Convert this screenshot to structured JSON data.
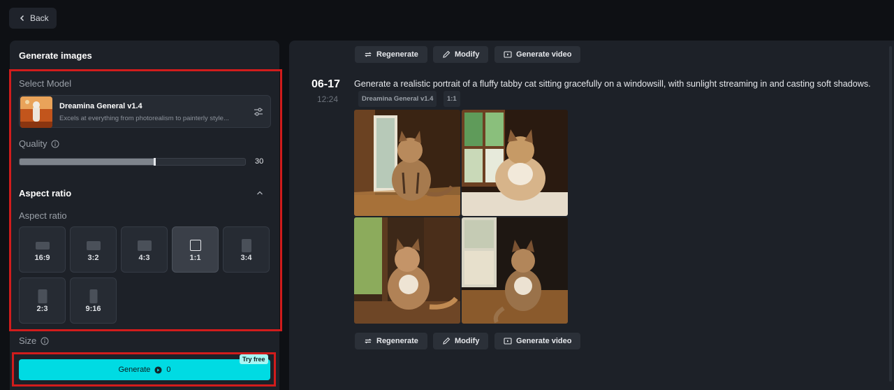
{
  "back": {
    "label": "Back"
  },
  "left_panel": {
    "title": "Generate images",
    "select_model_label": "Select Model",
    "model": {
      "name": "Dreamina General v1.4",
      "description": "Excels at everything from photorealism to painterly style..."
    },
    "quality": {
      "label": "Quality",
      "value": "30",
      "fill_fraction": 0.6
    },
    "aspect_section": {
      "heading": "Aspect ratio",
      "sub_label": "Aspect ratio",
      "options": [
        "16:9",
        "3:2",
        "4:3",
        "1:1",
        "3:4",
        "2:3",
        "9:16"
      ],
      "selected": "1:1"
    },
    "size_label": "Size",
    "generate": {
      "label": "Generate",
      "cost": "0",
      "badge": "Try free"
    }
  },
  "result": {
    "actions_top": [
      "Regenerate",
      "Modify",
      "Generate video"
    ],
    "actions_bottom": [
      "Regenerate",
      "Modify",
      "Generate video"
    ],
    "date": "06-17",
    "time": "12:24",
    "prompt": "Generate a realistic portrait of a fluffy tabby cat sitting gracefully on a windowsill, with sunlight streaming in and casting soft shadows.",
    "tags": [
      "Dreamina General v1.4",
      "1:1"
    ],
    "images_count": 4
  },
  "colors": {
    "accent": "#00dbe3",
    "highlight_border": "#d11c1c",
    "panel_bg": "#1d2128",
    "page_bg": "#0e1014"
  }
}
